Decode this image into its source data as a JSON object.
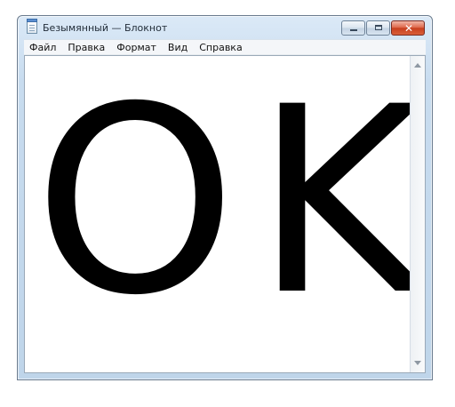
{
  "window": {
    "title": "Безымянный — Блокнот"
  },
  "title_buttons": {
    "minimize": "minimize",
    "maximize": "maximize",
    "close": "close"
  },
  "menu": {
    "items": [
      "Файл",
      "Правка",
      "Формат",
      "Вид",
      "Справка"
    ]
  },
  "editor": {
    "text": "OK"
  }
}
